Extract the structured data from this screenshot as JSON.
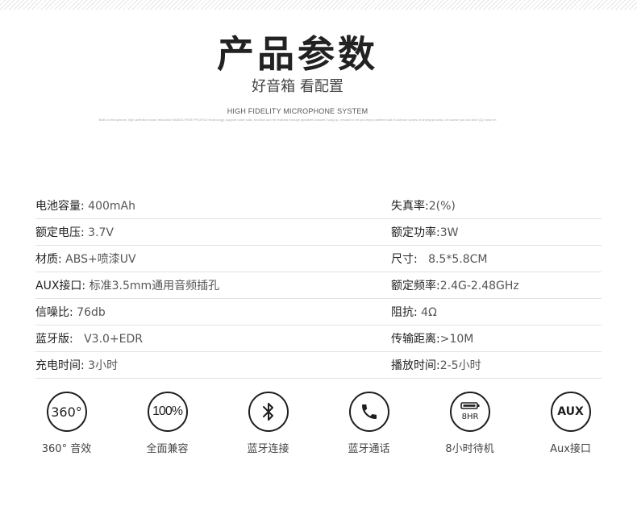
{
  "hero": {
    "title": "产品参数",
    "subtitle": "好音箱 看配置",
    "en_title": "HIGH FIDELITY MICROPHONE SYSTEM",
    "fine_print": "Built-in microphone, high-definition noise reduction HANDS-FREE PROFILE technology, support voice calls, function can be realized through speakers answer, hang up, refused to let you enjoy carefree talk in outdoor sports or driving process, of course you can love QQ voice ch"
  },
  "specs": [
    {
      "left": {
        "label": "电池容量:",
        "value": "400mAh"
      },
      "right": {
        "label": "失真率:",
        "value": "2(%)"
      }
    },
    {
      "left": {
        "label": "额定电压:",
        "value": "3.7V"
      },
      "right": {
        "label": "额定功率:",
        "value": "3W"
      }
    },
    {
      "left": {
        "label": "材质:",
        "value": "ABS+喷漆UV"
      },
      "right": {
        "label": "尺寸:",
        "value": "8.5*5.8CM"
      }
    },
    {
      "left": {
        "label": "AUX接口:",
        "value": "标准3.5mm通用音频插孔"
      },
      "right": {
        "label": "额定频率:",
        "value": "2.4G-2.48GHz"
      }
    },
    {
      "left": {
        "label": "信噪比:",
        "value": "76db"
      },
      "right": {
        "label": "阻抗:",
        "value": "4Ω"
      }
    },
    {
      "left": {
        "label": "蓝牙版:",
        "value": "V3.0+EDR"
      },
      "right": {
        "label": "传输距离:",
        "value": ">10M"
      }
    },
    {
      "left": {
        "label": "充电时间:",
        "value": "3小时"
      },
      "right": {
        "label": "播放时间:",
        "value": "2-5小时"
      }
    }
  ],
  "features": [
    {
      "icon_text": "360°",
      "icon": "360-icon",
      "label": "360° 音效"
    },
    {
      "icon_text": "100%",
      "icon": "percent-100-icon",
      "label": "全面兼容"
    },
    {
      "icon": "bluetooth-icon",
      "label": "蓝牙连接"
    },
    {
      "icon": "phone-icon",
      "label": "蓝牙通话"
    },
    {
      "icon_text": "8HR",
      "icon": "battery-8hr-icon",
      "label": "8小时待机"
    },
    {
      "icon_text": "AUX",
      "icon": "aux-icon",
      "label": "Aux接口"
    }
  ]
}
